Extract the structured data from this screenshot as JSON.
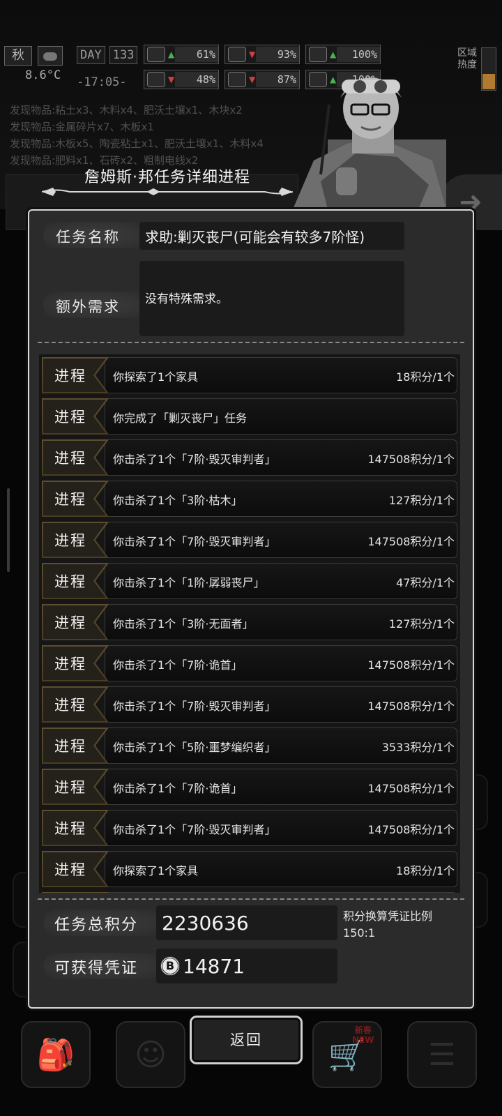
{
  "hud": {
    "season": "秋",
    "temperature": "8.6°C",
    "day_label": "DAY",
    "day_number": "133",
    "time": "-17:05-",
    "stats": [
      {
        "icon": "medkit-icon",
        "value": "61%",
        "trend": "up"
      },
      {
        "icon": "stomach-icon",
        "value": "93%",
        "trend": "down"
      },
      {
        "icon": "battery-icon",
        "value": "100%",
        "trend": "up"
      },
      {
        "icon": "brain-icon",
        "value": "48%",
        "trend": "down"
      },
      {
        "icon": "water-drop-icon",
        "value": "87%",
        "trend": "down"
      },
      {
        "icon": "heart-icon",
        "value": "100%",
        "trend": "up"
      }
    ],
    "region_heat": "区域\n热度"
  },
  "log": [
    "发现物品:粘土x3、木料x4、肥沃土壤x1、木块x2",
    "发现物品:金属碎片x7、木板x1",
    "发现物品:木板x5、陶瓷粘土x1、肥沃土壤x1、木料x4",
    "发现物品:肥料x1、石砖x2、粗制电线x2"
  ],
  "dialog": {
    "title": "詹姆斯·邦任务详细进程",
    "task_name_label": "任务名称",
    "task_name_value": "求助:剿灭丧尸(可能会有较多7阶怪)",
    "extra_req_label": "额外需求",
    "extra_req_value": "没有特殊需求。",
    "progress_tag": "进程",
    "progress": [
      {
        "desc": "你探索了1个家具",
        "points": "18积分/1个"
      },
      {
        "desc": "你完成了「剿灭丧尸」任务",
        "points": ""
      },
      {
        "desc": "你击杀了1个「7阶·毁灭审判者」",
        "points": "147508积分/1个"
      },
      {
        "desc": "你击杀了1个「3阶·枯木」",
        "points": "127积分/1个"
      },
      {
        "desc": "你击杀了1个「7阶·毁灭审判者」",
        "points": "147508积分/1个"
      },
      {
        "desc": "你击杀了1个「1阶·孱弱丧尸」",
        "points": "47积分/1个"
      },
      {
        "desc": "你击杀了1个「3阶·无面者」",
        "points": "127积分/1个"
      },
      {
        "desc": "你击杀了1个「7阶·诡首」",
        "points": "147508积分/1个"
      },
      {
        "desc": "你击杀了1个「7阶·毁灭审判者」",
        "points": "147508积分/1个"
      },
      {
        "desc": "你击杀了1个「5阶·噩梦编织者」",
        "points": "3533积分/1个"
      },
      {
        "desc": "你击杀了1个「7阶·诡首」",
        "points": "147508积分/1个"
      },
      {
        "desc": "你击杀了1个「7阶·毁灭审判者」",
        "points": "147508积分/1个"
      },
      {
        "desc": "你探索了1个家具",
        "points": "18积分/1个"
      }
    ],
    "total_points_label": "任务总积分",
    "total_points_value": "2230636",
    "ratio_label": "积分换算凭证比例",
    "ratio_value": "150:1",
    "voucher_label": "可获得凭证",
    "voucher_value": "14871",
    "back_label": "返回"
  },
  "bottom_nav": [
    {
      "icon": "backpack-icon"
    },
    {
      "icon": "brain-head-icon"
    },
    {
      "icon": "shopping-cart-icon",
      "badge": "新春\nNEW"
    },
    {
      "icon": "menu-list-icon"
    }
  ]
}
